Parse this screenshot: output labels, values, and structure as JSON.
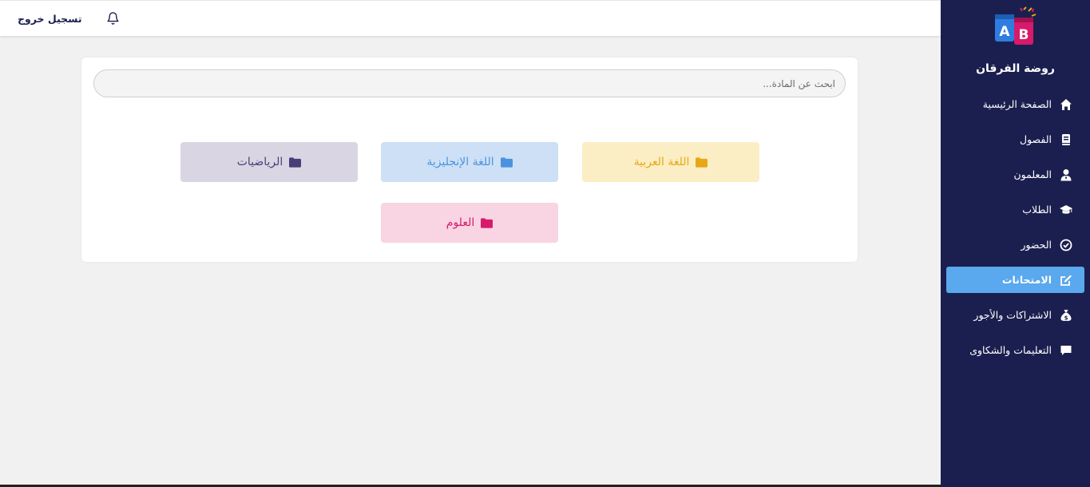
{
  "topbar": {
    "logout_label": "تسجيل خروج",
    "bell_icon": "bell-icon"
  },
  "sidebar": {
    "logo_letters": [
      "A",
      "B"
    ],
    "brand": "روضة الفرقان",
    "items": [
      {
        "label": "الصفحة الرئيسية",
        "icon": "home-icon",
        "active": false
      },
      {
        "label": "الفصول",
        "icon": "book-icon",
        "active": false
      },
      {
        "label": "المعلمون",
        "icon": "teacher-icon",
        "active": false
      },
      {
        "label": "الطلاب",
        "icon": "graduation-cap-icon",
        "active": false
      },
      {
        "label": "الحضور",
        "icon": "check-circle-icon",
        "active": false
      },
      {
        "label": "الامتحانات",
        "icon": "edit-icon",
        "active": true
      },
      {
        "label": "الاشتراكات والأجور",
        "icon": "money-bag-icon",
        "active": false
      },
      {
        "label": "التعليمات والشكاوى",
        "icon": "comment-icon",
        "active": false
      }
    ]
  },
  "main": {
    "search_placeholder": "ابحث عن المادة...",
    "subjects": [
      {
        "label": "اللغة العربية",
        "icon": "folder-icon",
        "color": "#e8a815"
      },
      {
        "label": "اللغة الإنجليزية",
        "icon": "folder-icon",
        "color": "#4c93de"
      },
      {
        "label": "الرياضيات",
        "icon": "folder-icon",
        "color": "#4a3e78"
      },
      {
        "label": "العلوم",
        "icon": "folder-icon",
        "color": "#d71a6b"
      }
    ]
  },
  "colors": {
    "sidebar_bg": "#1b1f4f",
    "active_item": "#5aa8ee",
    "page_bg": "#f1f1f1"
  }
}
